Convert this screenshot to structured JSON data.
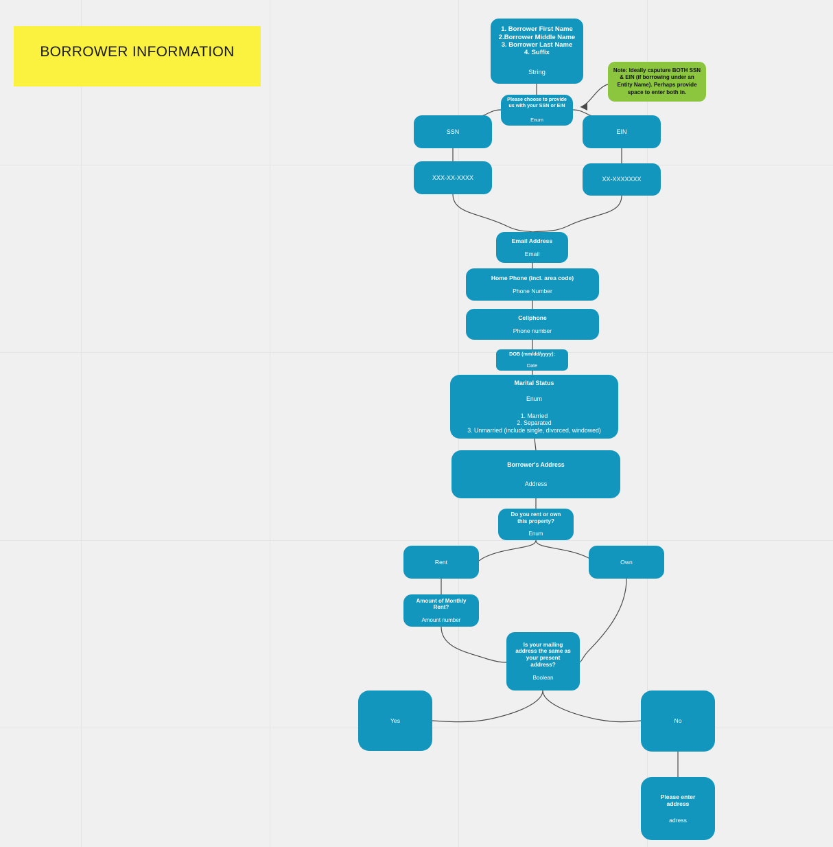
{
  "banner": {
    "label": "BORROWER INFORMATION",
    "color": "#fbf13f"
  },
  "theme": {
    "node_fill": "#1296bd",
    "note_fill": "#8cc63f",
    "canvas_bg": "#f0f0f0",
    "gridline": "#e4e4e4",
    "connector": "#4a4a4a",
    "node_text": "#ffffff"
  },
  "nodes": {
    "names": {
      "title": "1. Borrower First Name\n2.Borrower Middle Name\n3. Borrower Last Name\n4. Suffix",
      "subtitle": "String"
    },
    "ssn_or_ein": {
      "title": "Please choose to provide\nus with your SSN or EIN",
      "subtitle": "Enum"
    },
    "ssn": {
      "title": "SSN"
    },
    "ein": {
      "title": "EIN"
    },
    "ssn_format": {
      "title": "XXX-XX-XXXX"
    },
    "ein_format": {
      "title": "XX-XXXXXXX"
    },
    "email": {
      "title": "Email Address",
      "subtitle": "Email"
    },
    "home_phone": {
      "title": "Home Phone (incl. area code)",
      "subtitle": "Phone Number"
    },
    "cellphone": {
      "title": "Cellphone",
      "subtitle": "Phone number"
    },
    "dob": {
      "title": "DOB (mm/dd/yyyy):",
      "subtitle": "Date"
    },
    "marital_status": {
      "title": "Marital Status",
      "subtitle": "Enum",
      "options": "1. Married\n2. Separated\n3. Unmarried (include single, divorced, windowed)"
    },
    "borrower_address": {
      "title": "Borrower's Address",
      "subtitle": "Address"
    },
    "rent_or_own": {
      "title": "Do you rent or own\nthis property?",
      "subtitle": "Enum"
    },
    "rent": {
      "title": "Rent"
    },
    "own": {
      "title": "Own"
    },
    "monthly_rent": {
      "title": "Amount of Monthly\nRent?",
      "subtitle": "Amount number"
    },
    "mailing_same": {
      "title": "Is your mailing\naddress the same as\nyour present\naddress?",
      "subtitle": "Boolean"
    },
    "yes": {
      "title": "Yes"
    },
    "no": {
      "title": "No"
    },
    "enter_address": {
      "title": "Please enter\naddress",
      "subtitle": "adress"
    }
  },
  "note": {
    "text": "Note: Ideally caputure BOTH SSN & EIN (if borrowing under an Entity Name). Perhaps provide space to enter both in."
  }
}
